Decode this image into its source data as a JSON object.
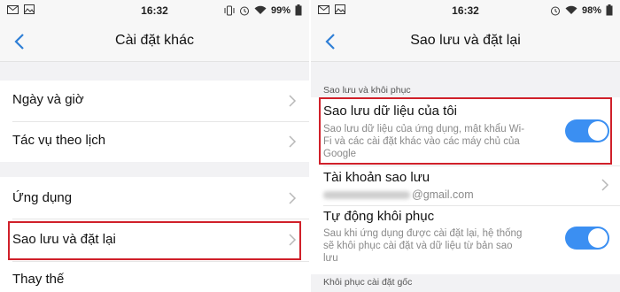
{
  "left": {
    "status": {
      "time": "16:32",
      "battery": "99%"
    },
    "title": "Cài đặt khác",
    "items": [
      {
        "label": "Ngày và giờ"
      },
      {
        "label": "Tác vụ theo lịch"
      },
      {
        "label": "Ứng dụng"
      },
      {
        "label": "Sao lưu và đặt lại"
      },
      {
        "label": "Thay thế"
      }
    ],
    "highlighted_item": "Sao lưu và đặt lại"
  },
  "right": {
    "status": {
      "time": "16:32",
      "battery": "98%"
    },
    "title": "Sao lưu và đặt lại",
    "section1_header": "Sao lưu và khôi phục",
    "backup_data": {
      "title": "Sao lưu dữ liệu của tôi",
      "desc_line1": "Sao lưu dữ liệu của ứng dụng, mật khẩu Wi-",
      "desc_line2": "Fi và các cài đặt khác vào các máy chủ của",
      "desc_line3": "Google",
      "enabled": true
    },
    "backup_account": {
      "title": "Tài khoản sao lưu",
      "email_suffix": "@gmail.com"
    },
    "auto_restore": {
      "title": "Tự động khôi phục",
      "desc_line1": "Sau khi ứng dụng được cài đặt lại, hệ thống",
      "desc_line2": "sẽ khôi phục cài đặt và dữ liệu từ bản sao",
      "desc_line3": "lưu",
      "enabled": true
    },
    "section2_header": "Khôi phục cài đặt gốc"
  },
  "colors": {
    "accent": "#3b8ff2",
    "highlight": "#d0202a"
  },
  "icons": [
    "mail-icon",
    "photo-icon",
    "vibrate-icon",
    "alarm-icon",
    "wifi-icon",
    "battery-icon",
    "back-arrow-icon",
    "chevron-right-icon"
  ]
}
